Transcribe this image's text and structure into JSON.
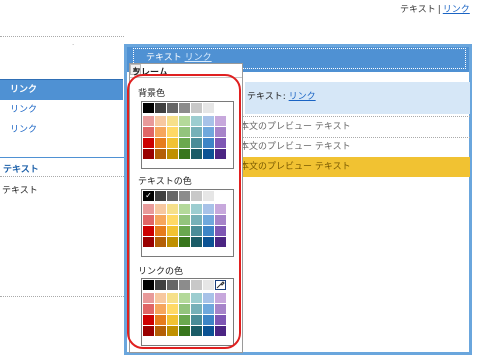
{
  "top": {
    "text": "テキスト",
    "sep": "|",
    "link": "リンク"
  },
  "nav": {
    "items": [
      "リンク",
      "リンク",
      "リンク"
    ]
  },
  "side": {
    "heading": "テキスト",
    "text": "テキスト"
  },
  "frame": {
    "header_text": "テキスト",
    "header_link": "リンク"
  },
  "band": {
    "text": "テキスト:",
    "link": "リンク"
  },
  "preview": {
    "rows": [
      "本文のプレビュー テキスト",
      "本文のプレビュー テキスト",
      "本文のプレビュー テキスト"
    ]
  },
  "popup": {
    "scroll_glyph": "▲",
    "title": "フレーム",
    "sections": [
      {
        "label": "背景色"
      },
      {
        "label": "テキストの色",
        "check_glyph": "✓"
      },
      {
        "label": "リンクの色",
        "icon": "eyedropper-icon"
      }
    ]
  },
  "colors": {
    "accent": "#4f91d3",
    "frame_border": "#6aa6dd",
    "highlight_row": "#f1c232",
    "annotation_red": "#e02020",
    "link": "#1a64c4",
    "palette_rows": [
      [
        "#000000",
        "#404040",
        "#666666",
        "#8c8c8c",
        "#c8c8c8",
        "#e6e6e6",
        "#ffffff"
      ],
      [
        "#e89a9a",
        "#f7c8a0",
        "#f6e08a",
        "#b4d99a",
        "#9ccdd0",
        "#a7c2e8",
        "#c7a8dc"
      ],
      [
        "#e06666",
        "#f6a65c",
        "#ffd966",
        "#93c47d",
        "#76b0b8",
        "#6fa8dc",
        "#a684c9"
      ],
      [
        "#cc0000",
        "#e67c1c",
        "#f1c232",
        "#6aa84f",
        "#4a8c98",
        "#3d85c6",
        "#7e57b4"
      ],
      [
        "#990000",
        "#b45f06",
        "#bf9000",
        "#38761d",
        "#1b5c67",
        "#0b5394",
        "#4b2583"
      ]
    ]
  }
}
